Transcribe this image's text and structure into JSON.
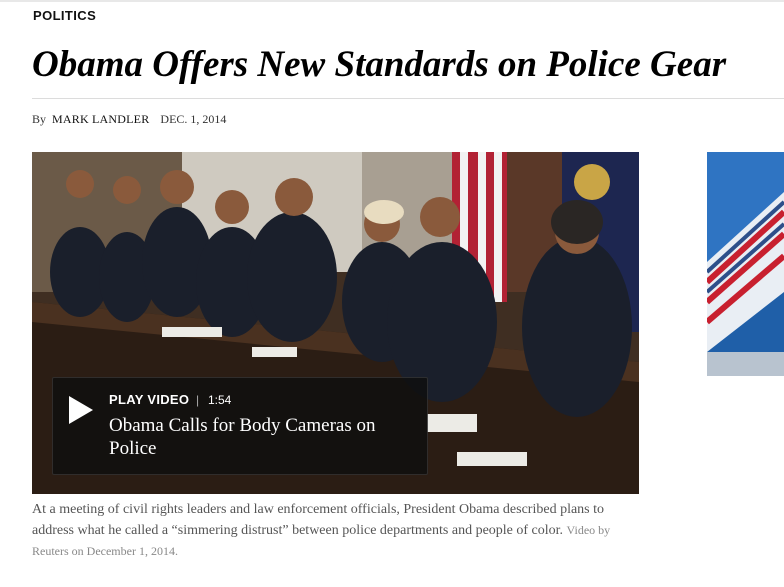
{
  "section": {
    "label": "POLITICS"
  },
  "article": {
    "headline": "Obama Offers New Standards on Police Gear",
    "byline_prefix": "By",
    "author": "MARK LANDLER",
    "date": "DEC. 1, 2014"
  },
  "video": {
    "play_label": "PLAY VIDEO",
    "separator": "|",
    "duration": "1:54",
    "title": "Obama Calls for Body Cameras on Police"
  },
  "caption": {
    "text": "At a meeting of civil rights leaders and law enforcement officials, President Obama described plans to address what he called a “simmering distrust” between police departments and people of color.",
    "credit": "Video by Reuters on December 1, 2014."
  },
  "icons": {
    "play": "play-icon"
  },
  "colors": {
    "overlay_bg": "#0f0f0f",
    "ad_blue": "#1b5a9e",
    "flag_red": "#b22234"
  }
}
